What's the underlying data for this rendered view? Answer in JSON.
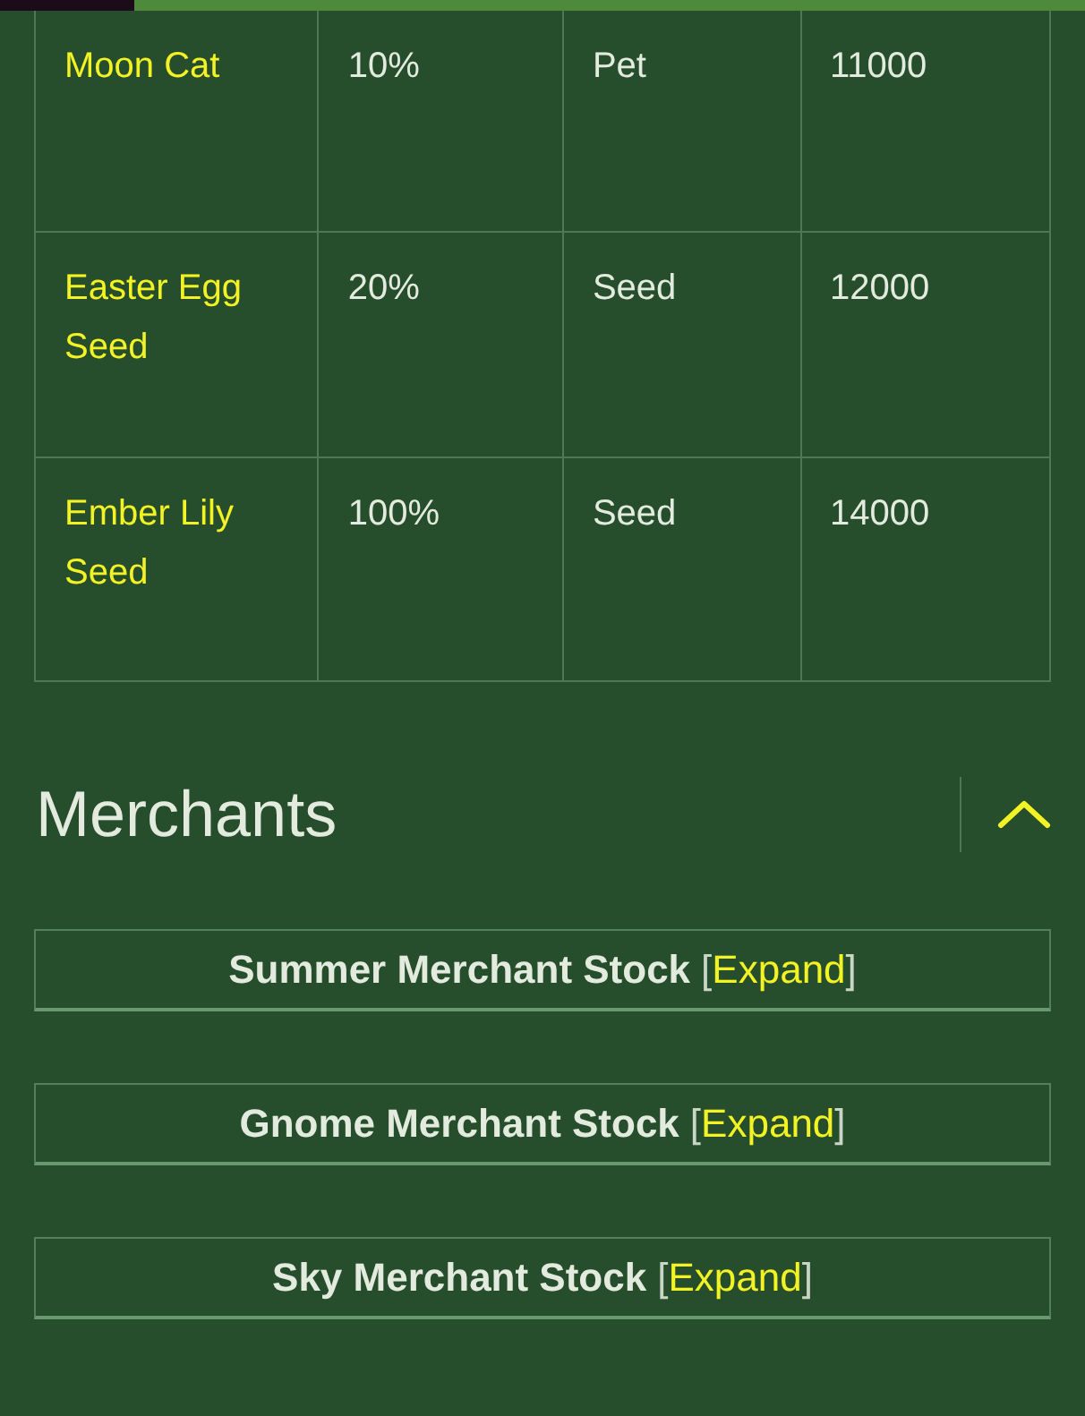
{
  "table": {
    "rows": [
      {
        "cells": [
          "Moon Cat",
          "10%",
          "Pet",
          "11000"
        ]
      },
      {
        "cells": [
          "Easter Egg Seed",
          "20%",
          "Seed",
          "12000"
        ]
      },
      {
        "cells": [
          "Ember Lily Seed",
          "100%",
          "Seed",
          "14000"
        ]
      }
    ]
  },
  "section": {
    "title": "Merchants",
    "expanded": true
  },
  "merchants": [
    {
      "title": "Summer Merchant Stock",
      "toggle": "[Expand]"
    },
    {
      "title": "Gnome Merchant Stock",
      "toggle": "[Expand]"
    },
    {
      "title": "Sky Merchant Stock",
      "toggle": "[Expand]"
    }
  ]
}
